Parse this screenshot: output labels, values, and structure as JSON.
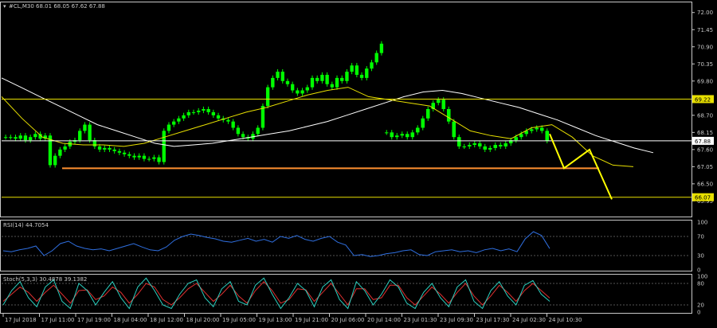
{
  "window": {
    "title": "#CL,M30 68.01 68.05 67.62 67.88",
    "icon": "chart-icon"
  },
  "colors": {
    "background": "#000000",
    "frame": "#c8c8c8",
    "candle": "#00ff00",
    "ma_slow": "#ffffff",
    "ma_fast": "#e8e000",
    "hline": "#e8e000",
    "support": "#ff9030",
    "forecast": "#ffff00",
    "rsi": "#2f6fe0",
    "stoch_main": "#2bd0c0",
    "stoch_signal": "#e03030",
    "price_label_bg": "#e8e000"
  },
  "indicators": {
    "rsi_label": "RSI(14) 44.7054",
    "stoch_label": "Stoch(5,3,3) 30.4878 39.1382"
  },
  "chart_data": [
    {
      "type": "candlestick",
      "title": "#CL,M30 68.01 68.05 67.62 67.88",
      "ylim": [
        65.5,
        72.3
      ],
      "y_ticks": [
        "72.00",
        "71.45",
        "70.90",
        "70.35",
        "69.80",
        "68.70",
        "68.15",
        "67.60",
        "67.05",
        "66.50",
        "65.95"
      ],
      "x_ticks": [
        "17 Jul 2018",
        "17 Jul 11:00",
        "17 Jul 19:00",
        "18 Jul 04:00",
        "18 Jul 12:00",
        "18 Jul 20:00",
        "19 Jul 05:00",
        "19 Jul 13:00",
        "19 Jul 21:00",
        "20 Jul 06:00",
        "20 Jul 14:00",
        "23 Jul 01:30",
        "23 Jul 09:30",
        "23 Jul 17:30",
        "24 Jul 02:30",
        "24 Jul 10:30"
      ],
      "price_levels": [
        {
          "value": 69.22,
          "label": "69.22",
          "style": "yellow-line"
        },
        {
          "value": 67.88,
          "label": "67.88",
          "style": "white-line"
        },
        {
          "value": 66.07,
          "label": "66.07",
          "style": "yellow-line"
        },
        {
          "value": 67.0,
          "label": "",
          "style": "orange-support"
        }
      ],
      "price_segments": [
        {
          "name": "",
          "values": [
            68.0,
            68.0,
            67.95,
            68.05,
            67.9,
            68.0,
            68.1,
            67.95,
            68.05,
            67.1,
            67.4,
            67.6,
            67.7,
            67.85,
            67.9,
            68.2,
            68.4,
            67.9,
            67.7,
            67.6,
            67.65,
            67.6,
            67.55,
            67.5,
            67.45,
            67.4,
            67.35,
            67.4,
            67.3,
            67.3,
            67.35,
            67.2,
            68.2,
            68.4,
            68.5,
            68.6,
            68.7,
            68.8,
            68.8,
            68.85,
            68.9,
            68.8,
            68.7,
            68.6,
            68.55,
            68.5,
            68.3,
            68.1,
            68.0,
            67.95,
            68.1,
            68.3,
            69.0,
            69.6,
            69.9,
            70.1,
            69.8,
            69.7,
            69.5,
            69.4,
            69.5,
            69.6,
            69.9,
            69.8,
            70.0,
            69.7,
            69.6,
            69.9,
            69.8,
            70.1,
            70.3,
            70.0,
            69.9,
            70.2,
            70.4,
            70.7,
            71.0
          ]
        },
        {
          "name": "",
          "values": [
            68.15,
            68.0,
            68.05,
            68.1,
            68.0,
            68.15,
            68.3,
            68.6,
            68.9,
            69.1,
            69.2,
            68.9,
            68.5,
            68.0,
            67.7,
            67.7,
            67.75,
            67.8,
            67.7,
            67.6,
            67.65,
            67.75,
            67.7,
            67.8,
            67.9,
            68.0,
            68.1,
            68.2,
            68.25,
            68.3,
            68.2,
            67.88
          ]
        }
      ],
      "ma_slow": [
        69.9,
        69.6,
        69.3,
        69.0,
        68.7,
        68.4,
        68.2,
        68.0,
        67.8,
        67.7,
        67.75,
        67.8,
        67.9,
        68.0,
        68.1,
        68.2,
        68.35,
        68.5,
        68.7,
        68.9,
        69.1,
        69.3,
        69.45,
        69.5,
        69.4,
        69.25,
        69.1,
        68.95,
        68.75,
        68.55,
        68.3,
        68.05,
        67.85,
        67.65,
        67.5
      ],
      "ma_fast": [
        69.3,
        68.6,
        68.0,
        67.8,
        67.75,
        67.75,
        67.7,
        67.8,
        68.0,
        68.2,
        68.4,
        68.6,
        68.8,
        68.95,
        69.15,
        69.35,
        69.5,
        69.6,
        69.3,
        69.2,
        69.1,
        69.0,
        68.6,
        68.2,
        68.05,
        67.95,
        68.3,
        68.4,
        68.0,
        67.4,
        67.1,
        67.05
      ],
      "forecast": [
        68.1,
        67.0,
        67.6,
        66.0
      ]
    },
    {
      "type": "line",
      "title": "RSI(14) 44.7054",
      "ylim": [
        0,
        100
      ],
      "y_ticks": [
        "100",
        "70",
        "30",
        "0"
      ],
      "series": [
        {
          "name": "",
          "values": [
            40,
            38,
            42,
            45,
            50,
            30,
            40,
            55,
            60,
            50,
            45,
            42,
            44,
            40,
            45,
            50,
            55,
            48,
            42,
            40,
            48,
            62,
            70,
            75,
            72,
            68,
            65,
            60,
            58,
            62,
            66,
            60,
            64,
            58,
            70,
            66,
            72,
            64,
            60,
            66,
            70,
            58,
            52,
            30,
            32,
            28,
            30,
            34,
            36,
            40,
            42,
            32,
            30,
            38,
            40,
            42,
            38,
            40,
            36,
            42,
            45,
            40,
            44,
            38,
            65,
            80,
            72,
            44.7
          ]
        }
      ]
    },
    {
      "type": "line",
      "title": "Stoch(5,3,3) 30.4878 39.1382",
      "ylim": [
        0,
        100
      ],
      "y_ticks": [
        "100",
        "80",
        "20",
        "0"
      ],
      "series": [
        {
          "name": "",
          "values": [
            20,
            60,
            85,
            40,
            15,
            70,
            90,
            30,
            10,
            80,
            60,
            20,
            55,
            85,
            40,
            10,
            70,
            95,
            60,
            20,
            10,
            50,
            80,
            90,
            40,
            15,
            65,
            85,
            30,
            20,
            75,
            95,
            50,
            10,
            40,
            80,
            60,
            15,
            70,
            90,
            35,
            10,
            85,
            60,
            20,
            50,
            90,
            70,
            25,
            10,
            55,
            80,
            40,
            15,
            70,
            90,
            30,
            10,
            60,
            85,
            45,
            20,
            75,
            88,
            50,
            30
          ]
        },
        {
          "name": "",
          "values": [
            30,
            50,
            70,
            55,
            30,
            55,
            75,
            50,
            25,
            60,
            62,
            35,
            45,
            70,
            55,
            25,
            50,
            80,
            70,
            35,
            20,
            40,
            65,
            80,
            55,
            30,
            50,
            75,
            45,
            25,
            60,
            85,
            60,
            25,
            35,
            65,
            62,
            30,
            55,
            80,
            50,
            20,
            65,
            65,
            35,
            40,
            75,
            75,
            40,
            20,
            45,
            70,
            50,
            25,
            55,
            80,
            45,
            20,
            45,
            75,
            55,
            30,
            60,
            80,
            60,
            39
          ]
        }
      ]
    }
  ]
}
